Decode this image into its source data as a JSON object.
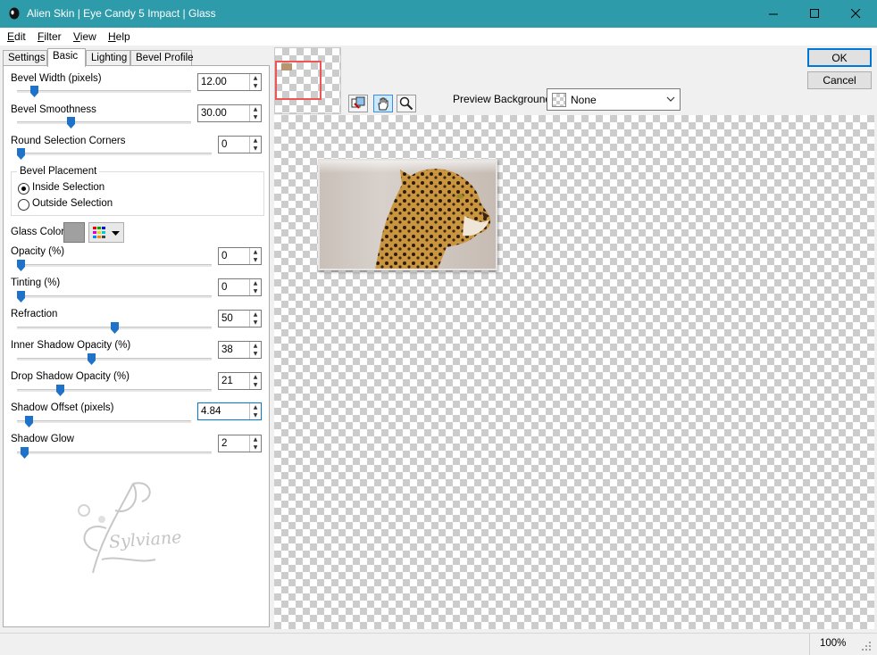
{
  "window": {
    "title": "Alien Skin | Eye Candy 5 Impact | Glass",
    "minimize_icon": "minimize-icon",
    "maximize_icon": "maximize-icon",
    "close_icon": "close-icon"
  },
  "menu": [
    {
      "label": "Edit",
      "accel": "E",
      "rest": "dit"
    },
    {
      "label": "Filter",
      "accel": "F",
      "rest": "ilter"
    },
    {
      "label": "View",
      "accel": "V",
      "rest": "iew"
    },
    {
      "label": "Help",
      "accel": "H",
      "rest": "elp"
    }
  ],
  "tabs": [
    "Settings",
    "Basic",
    "Lighting",
    "Bevel Profile"
  ],
  "active_tab": "Basic",
  "controls": {
    "bevel_width": {
      "label": "Bevel Width (pixels)",
      "value": "12.00",
      "level": 0.08
    },
    "bevel_smoothness": {
      "label": "Bevel Smoothness",
      "value": "30.00",
      "level": 0.3
    },
    "round_corners": {
      "label": "Round Selection Corners",
      "value": "0",
      "level": 0
    },
    "bevel_placement": {
      "label": "Bevel Placement",
      "options": [
        "Inside Selection",
        "Outside Selection"
      ],
      "selected": "Inside Selection"
    },
    "glass_color": {
      "label": "Glass Color",
      "swatch": "#a0a0a0"
    },
    "opacity": {
      "label": "Opacity (%)",
      "value": "0",
      "level": 0
    },
    "tinting": {
      "label": "Tinting (%)",
      "value": "0",
      "level": 0
    },
    "refraction": {
      "label": "Refraction",
      "value": "50",
      "level": 0.5
    },
    "inner_shadow": {
      "label": "Inner Shadow Opacity (%)",
      "value": "38",
      "level": 0.38
    },
    "drop_shadow": {
      "label": "Drop Shadow Opacity (%)",
      "value": "21",
      "level": 0.21
    },
    "shadow_offset": {
      "label": "Shadow Offset (pixels)",
      "value": "4.84",
      "level": 0.05
    },
    "shadow_glow": {
      "label": "Shadow Glow",
      "value": "2",
      "level": 0.02
    }
  },
  "watermark": {
    "text": "Sylviane"
  },
  "buttons": {
    "ok": "OK",
    "cancel": "Cancel"
  },
  "preview": {
    "background_label": "Preview Background:",
    "background_value": "None",
    "tools": [
      "navigate-icon",
      "hand-icon",
      "zoom-icon"
    ]
  },
  "status": {
    "zoom": "100%"
  },
  "colors": {
    "titlebar": "#2e9bab",
    "accent": "#0078d7",
    "thumb": "#1e73c8"
  }
}
